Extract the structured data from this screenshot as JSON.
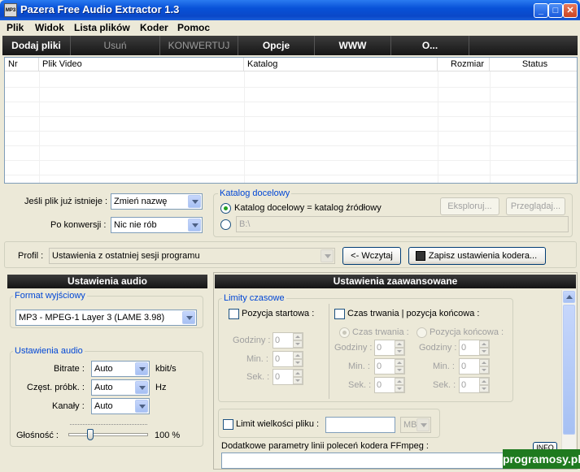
{
  "window": {
    "title": "Pazera Free Audio Extractor 1.3",
    "icon_text": "MP3"
  },
  "menu": [
    "Plik",
    "Widok",
    "Lista plików",
    "Koder",
    "Pomoc"
  ],
  "toolbar": [
    "Dodaj pliki",
    "Usuń",
    "KONWERTUJ",
    "Opcje",
    "WWW",
    "O..."
  ],
  "list": {
    "columns": [
      "Nr",
      "Plik Video",
      "Katalog",
      "Rozmiar",
      "Status"
    ]
  },
  "file_exists": {
    "label": "Jeśli plik już istnieje :",
    "value": "Zmień nazwę"
  },
  "after_convert": {
    "label": "Po konwersji :",
    "value": "Nic nie rób"
  },
  "output_dir": {
    "title": "Katalog docelowy",
    "option_same": "Katalog docelowy = katalog źródłowy",
    "path": "B:\\",
    "explore_label": "Eksploruj...",
    "browse_label": "Przeglądaj..."
  },
  "profile": {
    "label": "Profil :",
    "value": "Ustawienia z ostatniej sesji programu",
    "load_label": "<- Wczytaj",
    "save_label": "Zapisz ustawienia kodera..."
  },
  "audio_settings": {
    "header": "Ustawienia audio",
    "format_title": "Format wyjściowy",
    "format_value": "MP3 - MPEG-1 Layer 3 (LAME 3.98)",
    "group_title": "Ustawienia audio",
    "bitrate_label": "Bitrate :",
    "bitrate_value": "Auto",
    "bitrate_unit": "kbit/s",
    "sample_label": "Częst. próbk. :",
    "sample_value": "Auto",
    "sample_unit": "Hz",
    "channels_label": "Kanały :",
    "channels_value": "Auto",
    "volume_label": "Głośność :",
    "volume_value": "100 %",
    "volume_level": 0.25
  },
  "advanced": {
    "header": "Ustawienia zaawansowane",
    "time_title": "Limity czasowe",
    "start_label": "Pozycja startowa :",
    "duration_label": "Czas trwania | pozycja końcowa :",
    "radio_duration": "Czas trwania :",
    "radio_end": "Pozycja końcowa :",
    "hours": "Godziny :",
    "min": "Min. :",
    "sec": "Sek. :",
    "zero": "0",
    "size_limit_label": "Limit wielkości pliku :",
    "size_unit": "MB",
    "ffmpeg_label": "Dodatkowe parametry linii poleceń kodera FFmpeg :",
    "info_label": "INFO"
  },
  "watermark": "programosy.pl"
}
